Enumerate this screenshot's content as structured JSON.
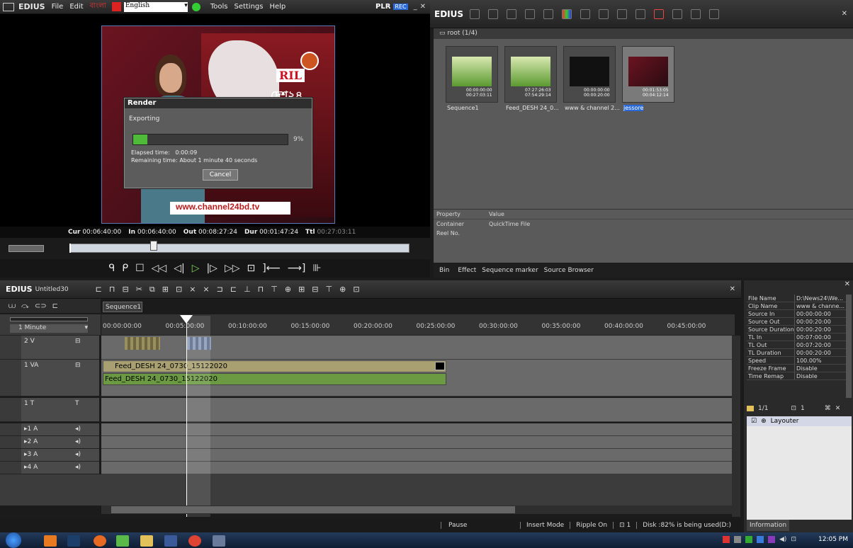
{
  "player": {
    "menu": [
      "EDIUS",
      "File",
      "Edit"
    ],
    "ime_lang": "বাংলা",
    "ime_dropdown": "English",
    "menu_right": [
      "Tools",
      "Settings",
      "Help"
    ],
    "mode": "PLR",
    "rec": "REC",
    "timecodes": {
      "cur_label": "Cur",
      "cur": "00:06:40:00",
      "in_label": "In",
      "in": "00:06:40:00",
      "out_label": "Out",
      "out": "00:08:27:24",
      "dur_label": "Dur",
      "dur": "00:01:47:24",
      "ttl_label": "Ttl",
      "ttl": "00:27:03:11"
    },
    "video_caption": "www.channel24bd.tv",
    "video_logo_text": "RIL",
    "video_logo_bangla": "দেশ২৪"
  },
  "render_dialog": {
    "title": "Render",
    "status": "Exporting",
    "progress": 0.09,
    "percent_label": "9%",
    "elapsed": "Elapsed time:   0:00:09",
    "remaining": "Remaining time: About 1 minute 40 seconds",
    "cancel": "Cancel"
  },
  "bin": {
    "title": "EDIUS",
    "folder": "root (1/4)",
    "clips": [
      {
        "name": "Sequence1",
        "tc1": "00:00:00:00",
        "tc2": "00:27:03:11",
        "selected": false
      },
      {
        "name": "Feed_DESH 24_0...",
        "tc1": "07:27:26:03",
        "tc2": "07:54:29:14",
        "selected": false
      },
      {
        "name": "www & channel 2...",
        "tc1": "00:00:00:00",
        "tc2": "00:00:20:00",
        "selected": false
      },
      {
        "name": "jessore",
        "tc1": "00:01:53:05",
        "tc2": "00:04:12:14",
        "selected": true
      }
    ],
    "prop_header": [
      "Property",
      "Value"
    ],
    "props": [
      [
        "Container",
        "QuickTime File"
      ],
      [
        "Reel No.",
        ""
      ]
    ],
    "tabs": [
      "Bin",
      "Effect",
      "Sequence marker",
      "Source Browser"
    ]
  },
  "timeline": {
    "title": "EDIUS",
    "project": "Untitled30",
    "sequence_tab": "Sequence1",
    "scale": "1 Minute",
    "ruler": [
      "00:00:00:00",
      "00:05:00:00",
      "00:10:00:00",
      "00:15:00:00",
      "00:20:00:00",
      "00:25:00:00",
      "00:30:00:00",
      "00:35:00:00",
      "00:40:00:00",
      "00:45:00:00"
    ],
    "tracks": [
      {
        "name": "2 V"
      },
      {
        "name": "1 VA"
      },
      {
        "name": "1 T"
      },
      {
        "name": "1 A"
      },
      {
        "name": "2 A"
      },
      {
        "name": "3 A"
      },
      {
        "name": "4 A"
      }
    ],
    "clip_video": "Feed_DESH 24_0730_15122020",
    "clip_audio": "Feed_DESH 24_0730_15122020",
    "status": [
      "Pause",
      "Insert Mode",
      "Ripple On",
      "1",
      "Disk :82% is being used(D:)"
    ]
  },
  "info": {
    "rows": [
      [
        "File Name",
        "D:\\News24\\We..."
      ],
      [
        "Clip Name",
        "www & channe..."
      ],
      [
        "Source In",
        "00:00:00:00"
      ],
      [
        "Source Out",
        "00:00:20:00"
      ],
      [
        "Source Duration",
        "00:00:20:00"
      ],
      [
        "TL In",
        "00:07:00:00"
      ],
      [
        "TL Out",
        "00:07:20:00"
      ],
      [
        "TL Duration",
        "00:00:20:00"
      ],
      [
        "Speed",
        "100.00%"
      ],
      [
        "Freeze Frame",
        "Disable"
      ],
      [
        "Time Remap",
        "Disable"
      ]
    ],
    "page": "1/1",
    "count": "1",
    "layer": "Layouter",
    "tab": "Information"
  },
  "taskbar": {
    "time": "12:05 PM"
  }
}
